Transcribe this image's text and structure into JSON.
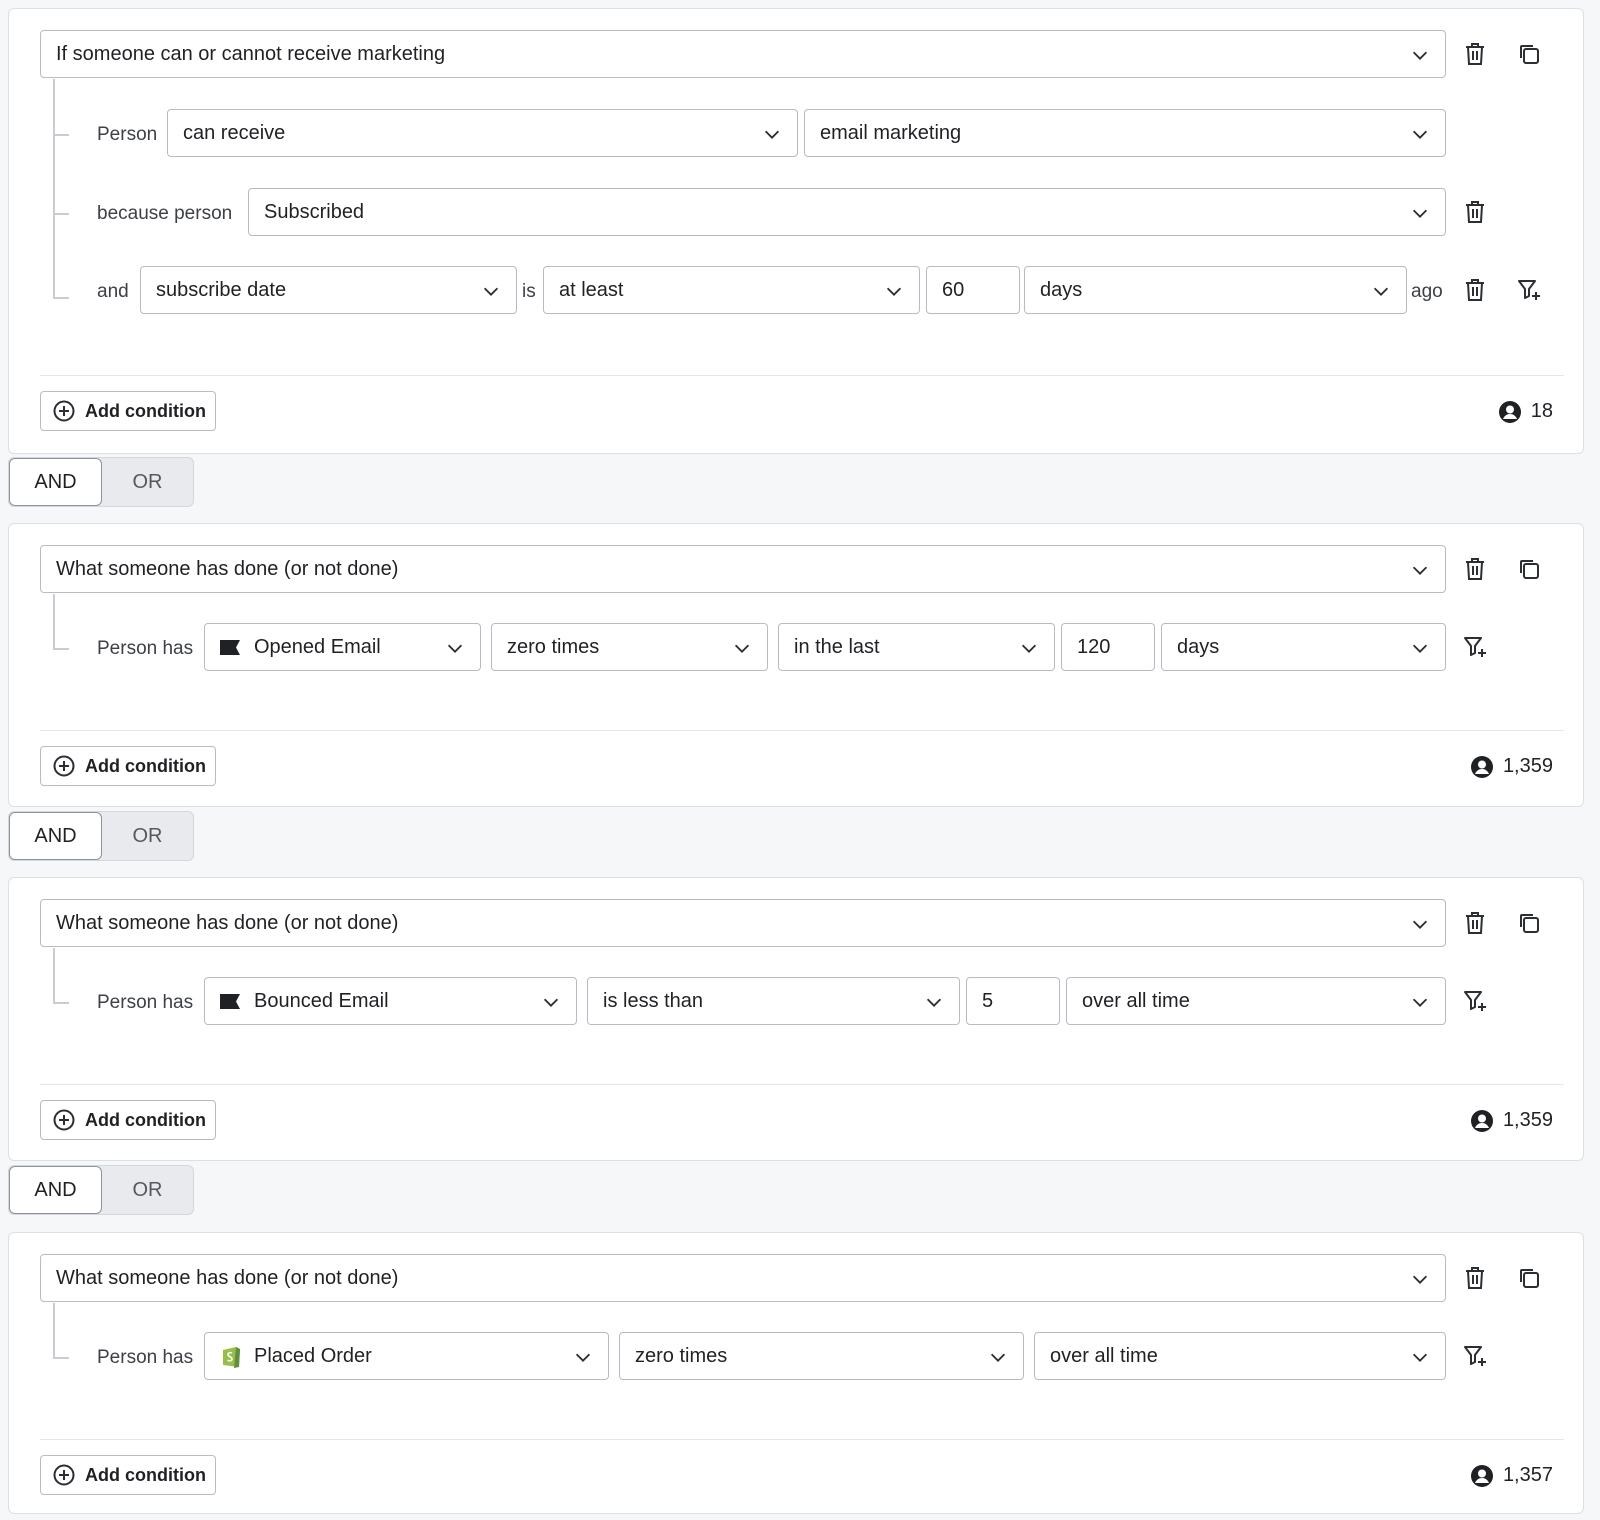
{
  "blocks": [
    {
      "type_label": "If someone can or cannot receive marketing",
      "rows": [
        {
          "label": "Person",
          "fields": [
            "can receive",
            "email marketing"
          ]
        },
        {
          "label": "because person",
          "fields": [
            "Subscribed"
          ]
        },
        {
          "label": "and",
          "fields": [
            "subscribe date",
            "at least",
            "60",
            "days"
          ],
          "infix": "is",
          "suffix": "ago"
        }
      ],
      "add_condition": "Add condition",
      "count": "18"
    },
    {
      "type_label": "What someone has done (or not done)",
      "rows": [
        {
          "label": "Person has",
          "fields": [
            "Opened Email",
            "zero times",
            "in the last",
            "120",
            "days"
          ]
        }
      ],
      "add_condition": "Add condition",
      "count": "1,359"
    },
    {
      "type_label": "What someone has done (or not done)",
      "rows": [
        {
          "label": "Person has",
          "fields": [
            "Bounced Email",
            "is less than",
            "5",
            "over all time"
          ]
        }
      ],
      "add_condition": "Add condition",
      "count": "1,359"
    },
    {
      "type_label": "What someone has done (or not done)",
      "rows": [
        {
          "label": "Person has",
          "fields": [
            "Placed Order",
            "zero times",
            "over all time"
          ]
        }
      ],
      "add_condition": "Add condition",
      "count": "1,357"
    }
  ],
  "toggles": [
    {
      "and": "AND",
      "or": "OR",
      "selected": "AND"
    },
    {
      "and": "AND",
      "or": "OR",
      "selected": "AND"
    },
    {
      "and": "AND",
      "or": "OR",
      "selected": "AND"
    }
  ],
  "icons": {
    "delete": "trash-icon",
    "duplicate": "copy-icon",
    "filter": "filter-add-icon",
    "chevron": "chevron-down-icon",
    "add": "plus-circle-icon",
    "profile": "user-circle-icon",
    "metric": "flag-icon",
    "integration": "shopify-icon"
  },
  "colors": {
    "border": "#b7bcc2",
    "background": "#f6f7f8",
    "shopify": "#95bf47"
  }
}
